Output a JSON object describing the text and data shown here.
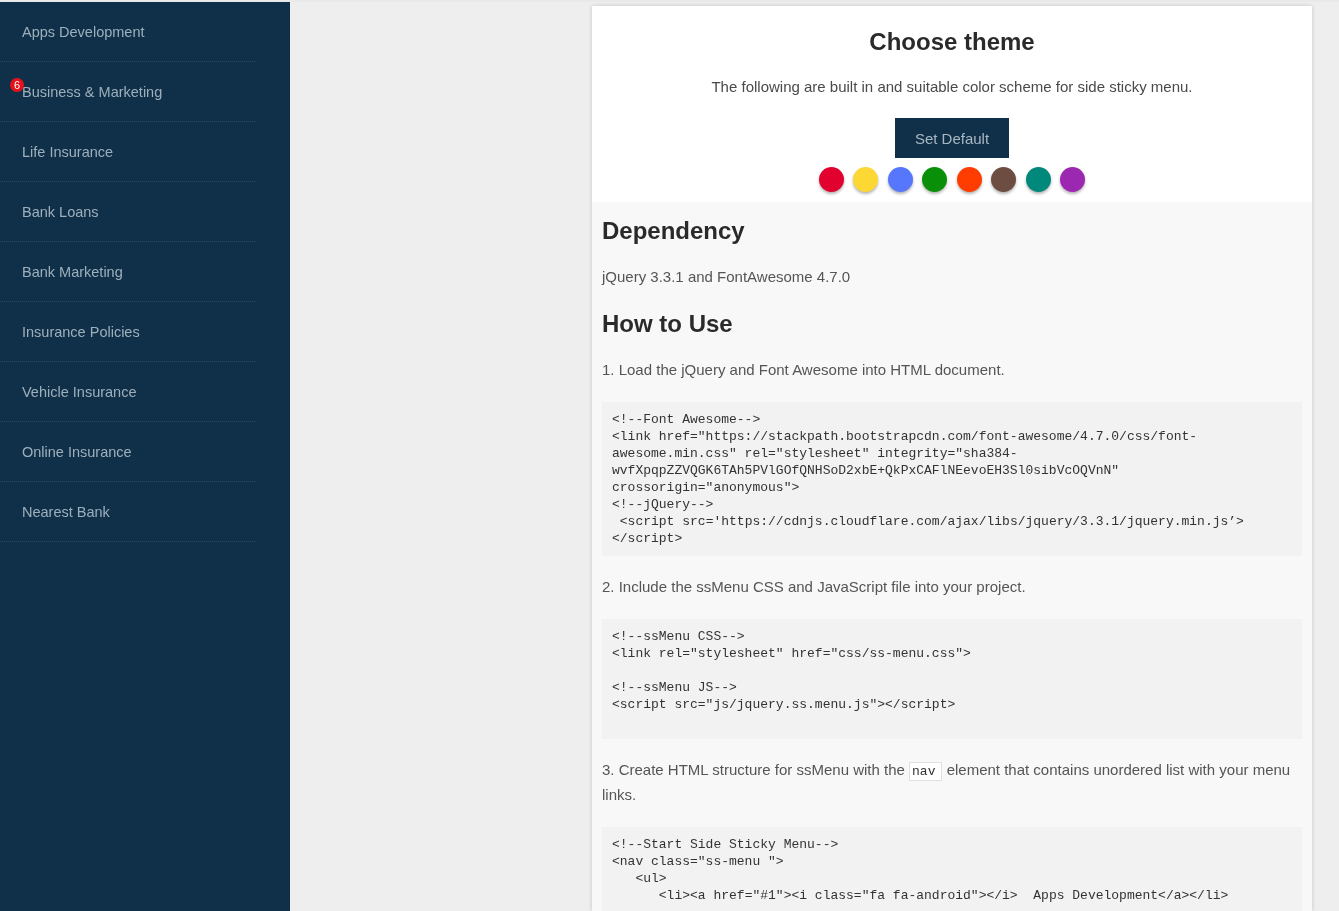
{
  "sidebar": {
    "items": [
      {
        "label": "Apps Development"
      },
      {
        "label": "Business & Marketing",
        "badge": "6"
      },
      {
        "label": "Life Insurance"
      },
      {
        "label": "Bank Loans"
      },
      {
        "label": "Bank Marketing"
      },
      {
        "label": "Insurance Policies"
      },
      {
        "label": "Vehicle Insurance"
      },
      {
        "label": "Online Insurance"
      },
      {
        "label": "Nearest Bank"
      }
    ]
  },
  "theme_card": {
    "title": "Choose theme",
    "description": "The following are built in and suitable color scheme for side sticky menu.",
    "button": "Set Default",
    "swatches": [
      {
        "color": "#e2002e"
      },
      {
        "color": "#fdd835"
      },
      {
        "color": "#5677fc"
      },
      {
        "color": "#0a8f08"
      },
      {
        "color": "#ff3d00"
      },
      {
        "color": "#6d4c41"
      },
      {
        "color": "#00897b"
      },
      {
        "color": "#9c27b0"
      }
    ]
  },
  "content": [
    {
      "kind": "heading",
      "text": "Dependency"
    },
    {
      "kind": "paragraph",
      "text": "jQuery 3.3.1 and FontAwesome 4.7.0"
    },
    {
      "kind": "heading",
      "text": "How to Use"
    },
    {
      "kind": "paragraph",
      "text": "1. Load the jQuery and Font Awesome into HTML document."
    },
    {
      "kind": "code",
      "text": "<!--Font Awesome-->\n<link href=\"https://stackpath.bootstrapcdn.com/font-awesome/4.7.0/css/font-awesome.min.css\" rel=\"stylesheet\" integrity=\"sha384-wvfXpqpZZVQGK6TAh5PVlGOfQNHSoD2xbE+QkPxCAFlNEevoEH3Sl0sibVcOQVnN\" crossorigin=\"anonymous\">\n<!--jQuery-->\n <script src='https://cdnjs.cloudflare.com/ajax/libs/jquery/3.3.1/jquery.min.js’>\n</script>"
    },
    {
      "kind": "paragraph",
      "text": "2. Include the ssMenu CSS and JavaScript file into your project."
    },
    {
      "kind": "code",
      "text": "<!--ssMenu CSS-->\n<link rel=\"stylesheet\" href=\"css/ss-menu.css\">\n\n<!--ssMenu JS-->\n<script src=\"js/jquery.ss.menu.js\"></script>\n\n"
    },
    {
      "kind": "mixed_paragraph",
      "parts": [
        {
          "kind": "text",
          "text": "3. Create HTML structure for ssMenu with the "
        },
        {
          "kind": "code",
          "text": "nav"
        },
        {
          "kind": "text",
          "text": " element that contains unordered list with your menu links."
        }
      ]
    },
    {
      "kind": "code",
      "text": "<!--Start Side Sticky Menu-->\n<nav class=\"ss-menu \">\n   <ul>\n      <li><a href=\"#1\"><i class=\"fa fa-android\"></i>  Apps Development</a></li>"
    }
  ]
}
